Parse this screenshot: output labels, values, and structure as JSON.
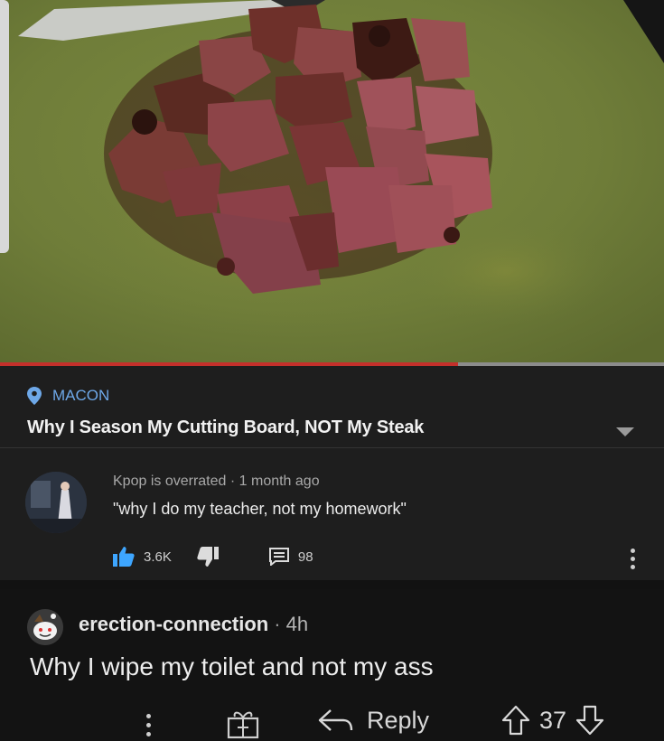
{
  "video": {
    "progress_fraction": 0.69
  },
  "post": {
    "location": "MACON",
    "title": "Why I Season My Cutting Board, NOT My Steak"
  },
  "yt_comment": {
    "author": "Kpop is overrated",
    "time": "1 month ago",
    "text": "\"why I do my teacher, not my homework\"",
    "likes": "3.6K",
    "replies": "98"
  },
  "reddit_comment": {
    "username": "erection-connection",
    "time": "4h",
    "text": "Why I wipe my toilet and not my ass",
    "reply_label": "Reply",
    "score": "37"
  },
  "colors": {
    "location_blue": "#6ea8e8",
    "progress_red": "#c4302b",
    "board_green": "#7d8a3e"
  }
}
